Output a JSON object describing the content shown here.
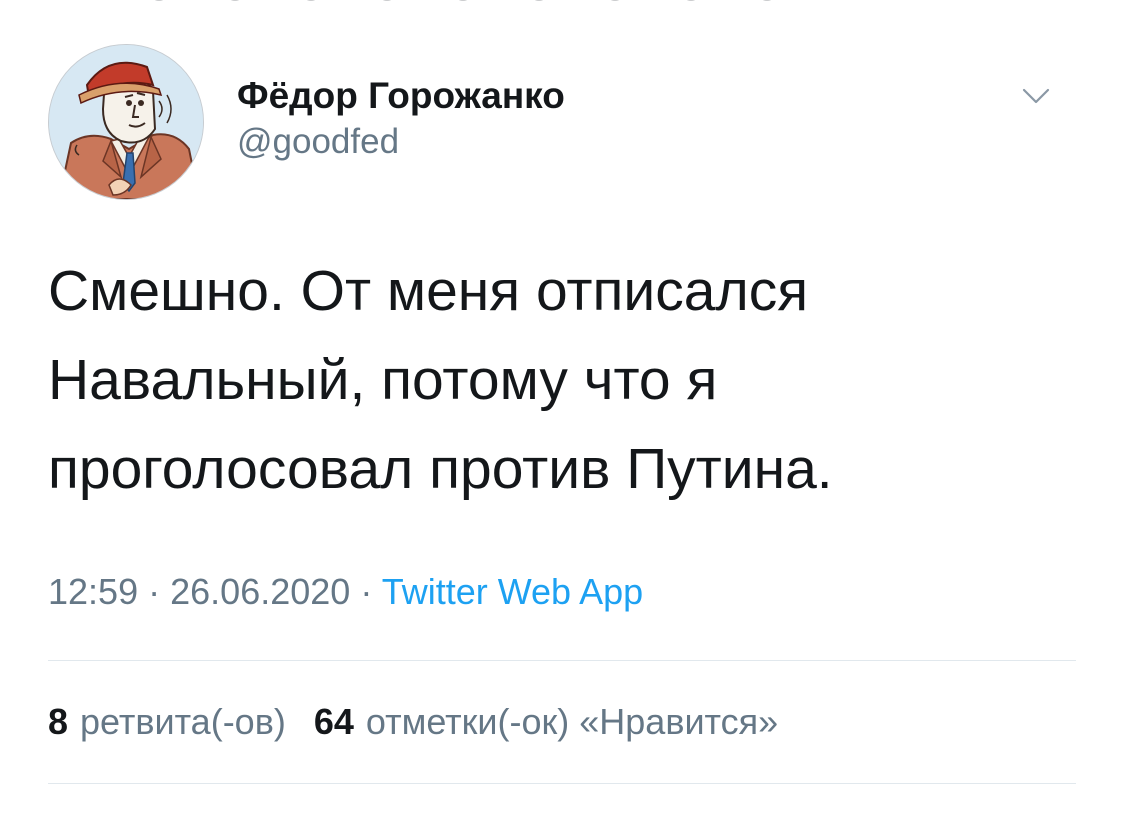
{
  "tweet": {
    "author": {
      "display_name": "Фёдор Горожанко",
      "handle": "@goodfed",
      "avatar_icon": "cartoon-man-avatar"
    },
    "text": "Смешно. От меня отписался Навальный, потому что я проголосовал против Путина.",
    "time": "12:59",
    "separator": "·",
    "date": "26.06.2020",
    "source_app": "Twitter Web App",
    "stats": {
      "retweets_count": "8",
      "retweets_label": "ретвита(-ов)",
      "likes_count": "64",
      "likes_label": "отметки(-ок) «Нравится»"
    }
  },
  "colors": {
    "text_primary": "#14171a",
    "text_secondary": "#657786",
    "link_blue": "#1da1f2",
    "divider": "#e1e8ed"
  }
}
